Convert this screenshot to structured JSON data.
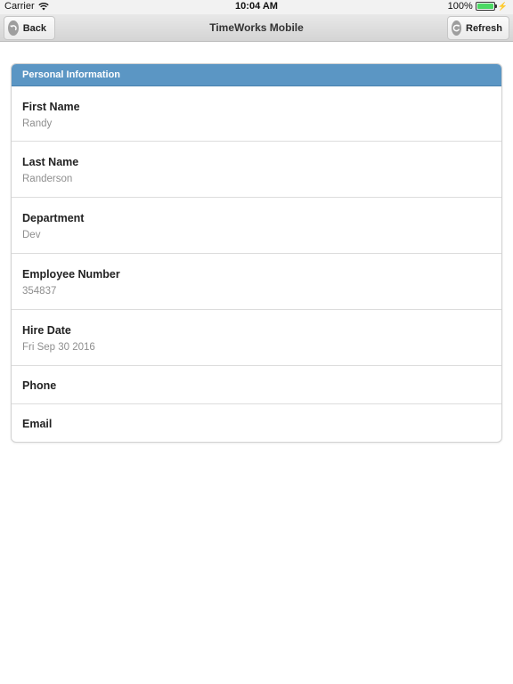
{
  "status_bar": {
    "carrier": "Carrier",
    "time": "10:04 AM",
    "battery_percent": "100%"
  },
  "header": {
    "title": "TimeWorks Mobile",
    "back_label": "Back",
    "refresh_label": "Refresh"
  },
  "section": {
    "title": "Personal Information",
    "fields": [
      {
        "label": "First Name",
        "value": "Randy"
      },
      {
        "label": "Last Name",
        "value": "Randerson"
      },
      {
        "label": "Department",
        "value": "Dev"
      },
      {
        "label": "Employee Number",
        "value": "354837"
      },
      {
        "label": "Hire Date",
        "value": "Fri Sep 30 2016"
      },
      {
        "label": "Phone",
        "value": ""
      },
      {
        "label": "Email",
        "value": ""
      }
    ]
  },
  "colors": {
    "section_header": "#5b96c4",
    "battery": "#4cd964"
  }
}
